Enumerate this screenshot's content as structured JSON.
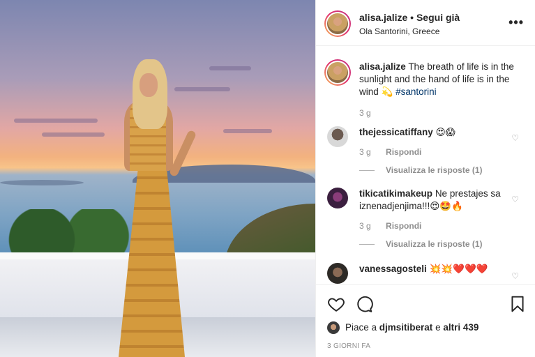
{
  "header": {
    "username": "alisa.jalize",
    "separator": "•",
    "follow_label": "Segui già",
    "location": "Ola Santorini, Greece",
    "more_icon": "more-horizontal-icon"
  },
  "caption": {
    "username": "alisa.jalize",
    "text": "The breath of life is in the sunlight and the hand of life is in the wind",
    "emoji": "💫",
    "hashtag": "#santorini",
    "time": "3 g"
  },
  "comments": [
    {
      "username": "thejessicatiffany",
      "text": "😍😱",
      "time": "3 g",
      "reply_label": "Rispondi",
      "view_replies": "Visualizza le risposte (1)",
      "avatar_color": "#bcbcbc"
    },
    {
      "username": "tikicatikimakeup",
      "text": "Ne prestajes sa iznenadjenjima!!!😍🤩🔥",
      "time": "3 g",
      "reply_label": "Rispondi",
      "view_replies": "Visualizza le risposte (1)",
      "avatar_color": "#3b1f3f"
    },
    {
      "username": "vanessagosteli",
      "text": "💥💥❤️❤️❤️",
      "avatar_color": "#2d2a26"
    }
  ],
  "actions": {
    "like_icon": "heart-outline-icon",
    "comment_icon": "comment-bubble-icon",
    "save_icon": "bookmark-icon"
  },
  "likes": {
    "prefix": "Piace a ",
    "user": "djmsitiberat",
    "middle": " e ",
    "others": "altri 439"
  },
  "date": "3 GIORNI FA"
}
